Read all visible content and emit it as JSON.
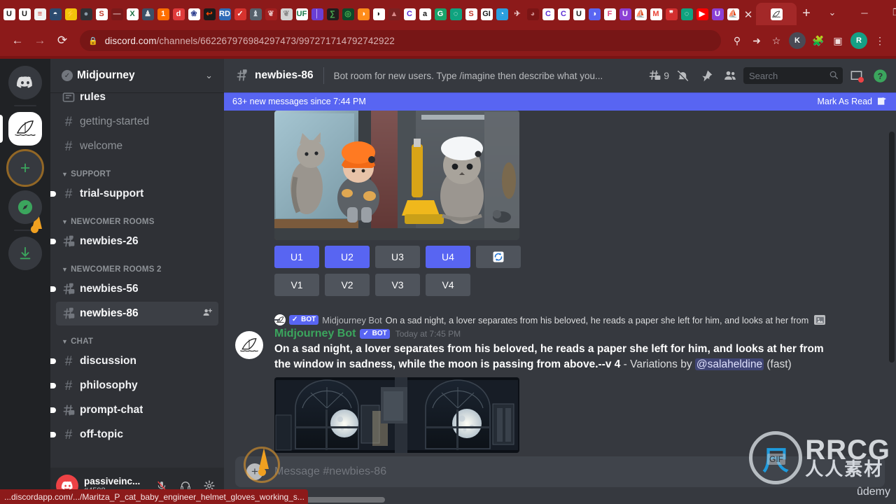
{
  "browser": {
    "url_prefix": "discord.com",
    "url_path": "/channels/662267976984297473/997271714792742922",
    "lock_icon": "lock-icon",
    "back_icon": "back-arrow-icon",
    "forward_icon": "forward-arrow-icon",
    "reload_icon": "reload-icon",
    "key_icon": "password-key-icon",
    "share_icon": "share-icon",
    "star_icon": "bookmark-star-icon",
    "extensions_icon": "puzzle-extensions-icon",
    "sidepanel_icon": "side-panel-icon",
    "menu_icon": "three-dot-menu-icon",
    "profile_initial": "R",
    "profile_color": "#14a085",
    "second_profile_initial": "K",
    "second_profile_color": "#4a4a55",
    "tab_close_label": "✕",
    "newtab_label": "+",
    "window_minimize": "─",
    "window_maximize": "❐",
    "window_close": "✕",
    "tab_list_label": "⌄",
    "chrome_bg": "#8c1a1a",
    "active_tab_bg": "#a32828",
    "favicons": [
      {
        "t": "U",
        "bg": "#ffffff",
        "fg": "#1a1a1a"
      },
      {
        "t": "U",
        "bg": "#ffffff",
        "fg": "#1a1a1a"
      },
      {
        "t": "≡",
        "bg": "#f2f2f2",
        "fg": "#c9342a"
      },
      {
        "t": "◓",
        "bg": "#2b4a6f",
        "fg": "#ffffff"
      },
      {
        "t": "⚡",
        "bg": "#f3c40a",
        "fg": "#1a1a1a"
      },
      {
        "t": "●",
        "bg": "#2f3136",
        "fg": "#8a9ba8"
      },
      {
        "t": "S",
        "bg": "#ffffff",
        "fg": "#c0392b"
      },
      {
        "t": "―",
        "bg": "#7a1a1a",
        "fg": "#d8b0b0"
      },
      {
        "t": "X",
        "bg": "#ffffff",
        "fg": "#1e7145"
      },
      {
        "t": "♟",
        "bg": "#3b5168",
        "fg": "#e4e4e4"
      },
      {
        "t": "1",
        "bg": "#ff6f00",
        "fg": "#ffffff"
      },
      {
        "t": "d",
        "bg": "#e03b3b",
        "fg": "#ffffff"
      },
      {
        "t": "❀",
        "bg": "#ffffff",
        "fg": "#2d3f8f"
      },
      {
        "t": "↩",
        "bg": "#1a1a1a",
        "fg": "#ff4500"
      },
      {
        "t": "RD",
        "bg": "#2e6bb8",
        "fg": "#ffffff"
      },
      {
        "t": "✓",
        "bg": "#d6332e",
        "fg": "#ffffff"
      },
      {
        "t": "♝",
        "bg": "#55606b",
        "fg": "#cfd6dd"
      },
      {
        "t": "❦",
        "bg": "#a31f1f",
        "fg": "#e8c0c0"
      },
      {
        "t": "❦",
        "bg": "#d4d4d4",
        "fg": "#8a8a8a"
      },
      {
        "t": "UF",
        "bg": "#ffffff",
        "fg": "#1b7a4a"
      },
      {
        "t": "│",
        "bg": "#6a3fd4",
        "fg": "#d8c8ff"
      },
      {
        "t": "∑",
        "bg": "#1e1e1e",
        "fg": "#4caf50"
      },
      {
        "t": "◎",
        "bg": "#0d4a2a",
        "fg": "#4caf50"
      },
      {
        "t": "◑",
        "bg": "#ff8c1a",
        "fg": "#ffffff"
      },
      {
        "t": "◗",
        "bg": "#ffffff",
        "fg": "#1a1a1a"
      },
      {
        "t": "▲",
        "bg": "#7a2222",
        "fg": "#d88a8a"
      },
      {
        "t": "C",
        "bg": "#ffffff",
        "fg": "#5b2dd4"
      },
      {
        "t": "a",
        "bg": "#ffffff",
        "fg": "#1a1a1a"
      },
      {
        "t": "G",
        "bg": "#1aa36b",
        "fg": "#ffffff"
      },
      {
        "t": "◌",
        "bg": "#10a37f",
        "fg": "#ffffff"
      },
      {
        "t": "S",
        "bg": "#ffffff",
        "fg": "#c0392b"
      },
      {
        "t": "GI",
        "bg": "#ffffff",
        "fg": "#1a1a1a"
      },
      {
        "t": "◔",
        "bg": "#2b9fe0",
        "fg": "#ffffff"
      },
      {
        "t": "✈",
        "bg": "#8c1a1a",
        "fg": "#e8c5c5"
      },
      {
        "t": "◕",
        "bg": "#7a1515",
        "fg": "#c98686"
      },
      {
        "t": "C",
        "bg": "#ffffff",
        "fg": "#5b2dd4"
      },
      {
        "t": "C",
        "bg": "#ffffff",
        "fg": "#5b2dd4"
      },
      {
        "t": "U",
        "bg": "#ffffff",
        "fg": "#1a1a1a"
      },
      {
        "t": "◑",
        "bg": "#5865f2",
        "fg": "#ffffff"
      },
      {
        "t": "F",
        "bg": "#ffffff",
        "fg": "#e0447c"
      },
      {
        "t": "U",
        "bg": "#8b3fd4",
        "fg": "#ffffff"
      },
      {
        "t": "⛵",
        "bg": "#ffffff",
        "fg": "#1a1a1a"
      },
      {
        "t": "M",
        "bg": "#ffffff",
        "fg": "#ea4335"
      },
      {
        "t": "❞",
        "bg": "#d32f2f",
        "fg": "#ffffff"
      },
      {
        "t": "◌",
        "bg": "#10a37f",
        "fg": "#ffffff"
      },
      {
        "t": "▶",
        "bg": "#ff0000",
        "fg": "#ffffff"
      },
      {
        "t": "U",
        "bg": "#8b3fd4",
        "fg": "#ffffff"
      },
      {
        "t": "⛵",
        "bg": "#ffffff",
        "fg": "#1a1a1a"
      }
    ],
    "active_tab_icon": "midjourney-sail-icon"
  },
  "status_bar": {
    "text": "...discordapp.com/.../Maritza_P_cat_baby_engineer_helmet_gloves_working_s..."
  },
  "guild_rail": {
    "items": [
      {
        "name": "direct-messages",
        "glyph": "🎮",
        "kind": "discord-home",
        "selected": false
      },
      {
        "name": "midjourney-server",
        "glyph": "⛵",
        "kind": "guild",
        "selected": true
      },
      {
        "name": "add-server",
        "glyph": "+",
        "kind": "add",
        "selected": false
      },
      {
        "name": "explore-servers",
        "glyph": "⦿",
        "kind": "compass",
        "selected": false
      },
      {
        "name": "download-apps",
        "glyph": "↓",
        "kind": "download",
        "selected": false
      }
    ]
  },
  "sidebar": {
    "guild_name": "Midjourney",
    "verified_check": "✓",
    "chevron": "⌄",
    "groups": [
      {
        "label": "",
        "channels": [
          {
            "label": "rules",
            "type": "announcement",
            "unread": true,
            "active": false,
            "partial": true
          },
          {
            "label": "getting-started",
            "type": "text",
            "unread": false,
            "active": false
          },
          {
            "label": "welcome",
            "type": "text",
            "unread": false,
            "active": false
          }
        ]
      },
      {
        "label": "SUPPORT",
        "channels": [
          {
            "label": "trial-support",
            "type": "text",
            "unread": true,
            "active": false
          }
        ]
      },
      {
        "label": "NEWCOMER ROOMS",
        "channels": [
          {
            "label": "newbies-26",
            "type": "forum-locked",
            "unread": true,
            "active": false
          }
        ]
      },
      {
        "label": "NEWCOMER ROOMS 2",
        "channels": [
          {
            "label": "newbies-56",
            "type": "forum-locked",
            "unread": true,
            "active": false
          },
          {
            "label": "newbies-86",
            "type": "forum-locked",
            "unread": false,
            "active": true,
            "trailing_icon": "add-member-icon"
          }
        ]
      },
      {
        "label": "CHAT",
        "channels": [
          {
            "label": "discussion",
            "type": "text",
            "unread": true,
            "active": false
          },
          {
            "label": "philosophy",
            "type": "text",
            "unread": true,
            "active": false
          },
          {
            "label": "prompt-chat",
            "type": "forum",
            "unread": true,
            "active": false
          },
          {
            "label": "off-topic",
            "type": "text",
            "unread": true,
            "active": false
          }
        ]
      }
    ]
  },
  "user_panel": {
    "username": "passiveinc...",
    "discriminator": "#4598",
    "avatar_icon": "discord-avatar-icon",
    "mute_icon": "microphone-muted-icon",
    "deafen_icon": "headphones-icon",
    "settings_icon": "gear-icon"
  },
  "chat_header": {
    "channel_name": "newbies-86",
    "channel_icon": "forum-locked-icon",
    "topic": "Bot room for new users. Type /imagine then describe what you...",
    "thread_count": "9",
    "thread_icon": "threads-icon",
    "notification_icon": "bell-muted-icon",
    "pin_icon": "pin-icon",
    "members_icon": "members-icon",
    "inbox_icon": "inbox-icon",
    "help_icon": "help-icon"
  },
  "search": {
    "placeholder": "Search",
    "magnifier_icon": "search-icon"
  },
  "new_messages_bar": {
    "text": "63+ new messages since 7:44 PM",
    "mark_label": "Mark As Read",
    "mark_icon": "mark-read-icon",
    "color": "#5865f2"
  },
  "messages": [
    {
      "id": "msg-cats",
      "attachment_alt": "Midjourney grid: cats and a baby in engineer helmets in a doorway",
      "buttons_row1": [
        {
          "label": "U1",
          "style": "primary"
        },
        {
          "label": "U2",
          "style": "primary"
        },
        {
          "label": "U3",
          "style": "secondary"
        },
        {
          "label": "U4",
          "style": "primary"
        },
        {
          "label": "⟳",
          "style": "secondary",
          "name": "reroll-button"
        }
      ],
      "buttons_row2": [
        {
          "label": "V1",
          "style": "secondary"
        },
        {
          "label": "V2",
          "style": "secondary"
        },
        {
          "label": "V3",
          "style": "secondary"
        },
        {
          "label": "V4",
          "style": "secondary"
        }
      ]
    },
    {
      "id": "msg-moon",
      "reply": {
        "author": "Midjourney Bot",
        "bot_tag": "BOT",
        "text": "On a sad night, a lover separates from his beloved, he reads a paper she left for him, and looks at her from",
        "attachment_chip_icon": "image-attachment-icon"
      },
      "author": "Midjourney Bot",
      "bot_tag": "BOT",
      "timestamp": "Today at 7:45 PM",
      "body_bold": "On a sad night, a lover separates from his beloved, he reads a paper she left for him, and looks at her from the window in sadness, while the moon is passing from above.--v 4",
      "body_rest_before": " - Variations by ",
      "mention": "@salaheldine",
      "body_rest_after": " (fast)",
      "attachment_alt": "Midjourney variations: moonlit arched windows in a dark room"
    }
  ],
  "composer": {
    "placeholder": "Message #newbies-86",
    "plus_icon": "add-attachment-icon"
  },
  "watermark": {
    "brand": "RRCG",
    "chinese": "人人素材",
    "udemy": "ûdemy",
    "gif_badge": "GIF",
    "logo_letter": "尺"
  }
}
